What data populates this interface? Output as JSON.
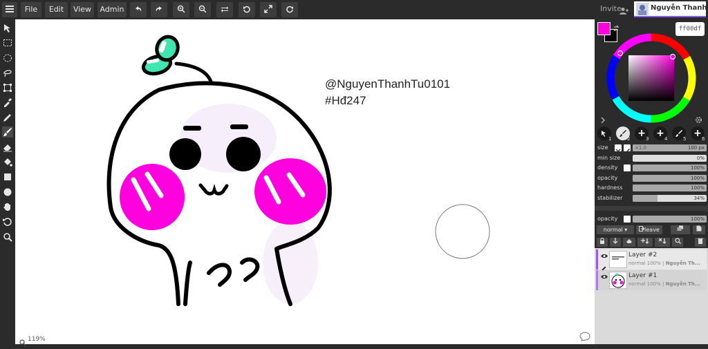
{
  "menu": {
    "file": "File",
    "edit": "Edit",
    "view": "View",
    "admin": "Admin"
  },
  "header": {
    "invite_label": "Invite",
    "user_name": "Nguyễn Thanh Tú"
  },
  "canvas": {
    "text_line1": "@NguyenThanhTu0101",
    "text_line2": "#Hđ247",
    "zoom_label": "119%"
  },
  "color": {
    "primary": "#ff00df",
    "secondary": "#000000",
    "hex": "ff00df"
  },
  "brushes": [
    {
      "num": "1"
    },
    {
      "num": "2"
    },
    {
      "num": "3"
    },
    {
      "num": "4"
    },
    {
      "num": "5"
    },
    {
      "num": "6"
    }
  ],
  "sliders": {
    "size": {
      "label": "size",
      "min_label": "×1.0",
      "value": "100 px",
      "fraction": 1.0
    },
    "min_size": {
      "label": "min size",
      "value": "0%",
      "fraction": 0.0
    },
    "density": {
      "label": "density",
      "value": "100%",
      "fraction": 1.0
    },
    "opacity": {
      "label": "opacity",
      "value": "100%",
      "fraction": 1.0
    },
    "hardness": {
      "label": "hardness",
      "value": "100%",
      "fraction": 1.0
    },
    "stabilizer": {
      "label": "stabilizer",
      "value": "34%",
      "fraction": 0.34
    },
    "layer_opacity": {
      "label": "opacity",
      "value": "100%",
      "fraction": 1.0
    }
  },
  "layer_controls": {
    "blend_mode": "normal ▾",
    "leave": "leave"
  },
  "layers": [
    {
      "name": "Layer #2",
      "meta_prefix": "normal 100% | ",
      "meta_owner": "Nguyễn Th..."
    },
    {
      "name": "Layer #1",
      "meta_prefix": "normal 100% | ",
      "meta_owner": "Nguyễn Th..."
    }
  ]
}
